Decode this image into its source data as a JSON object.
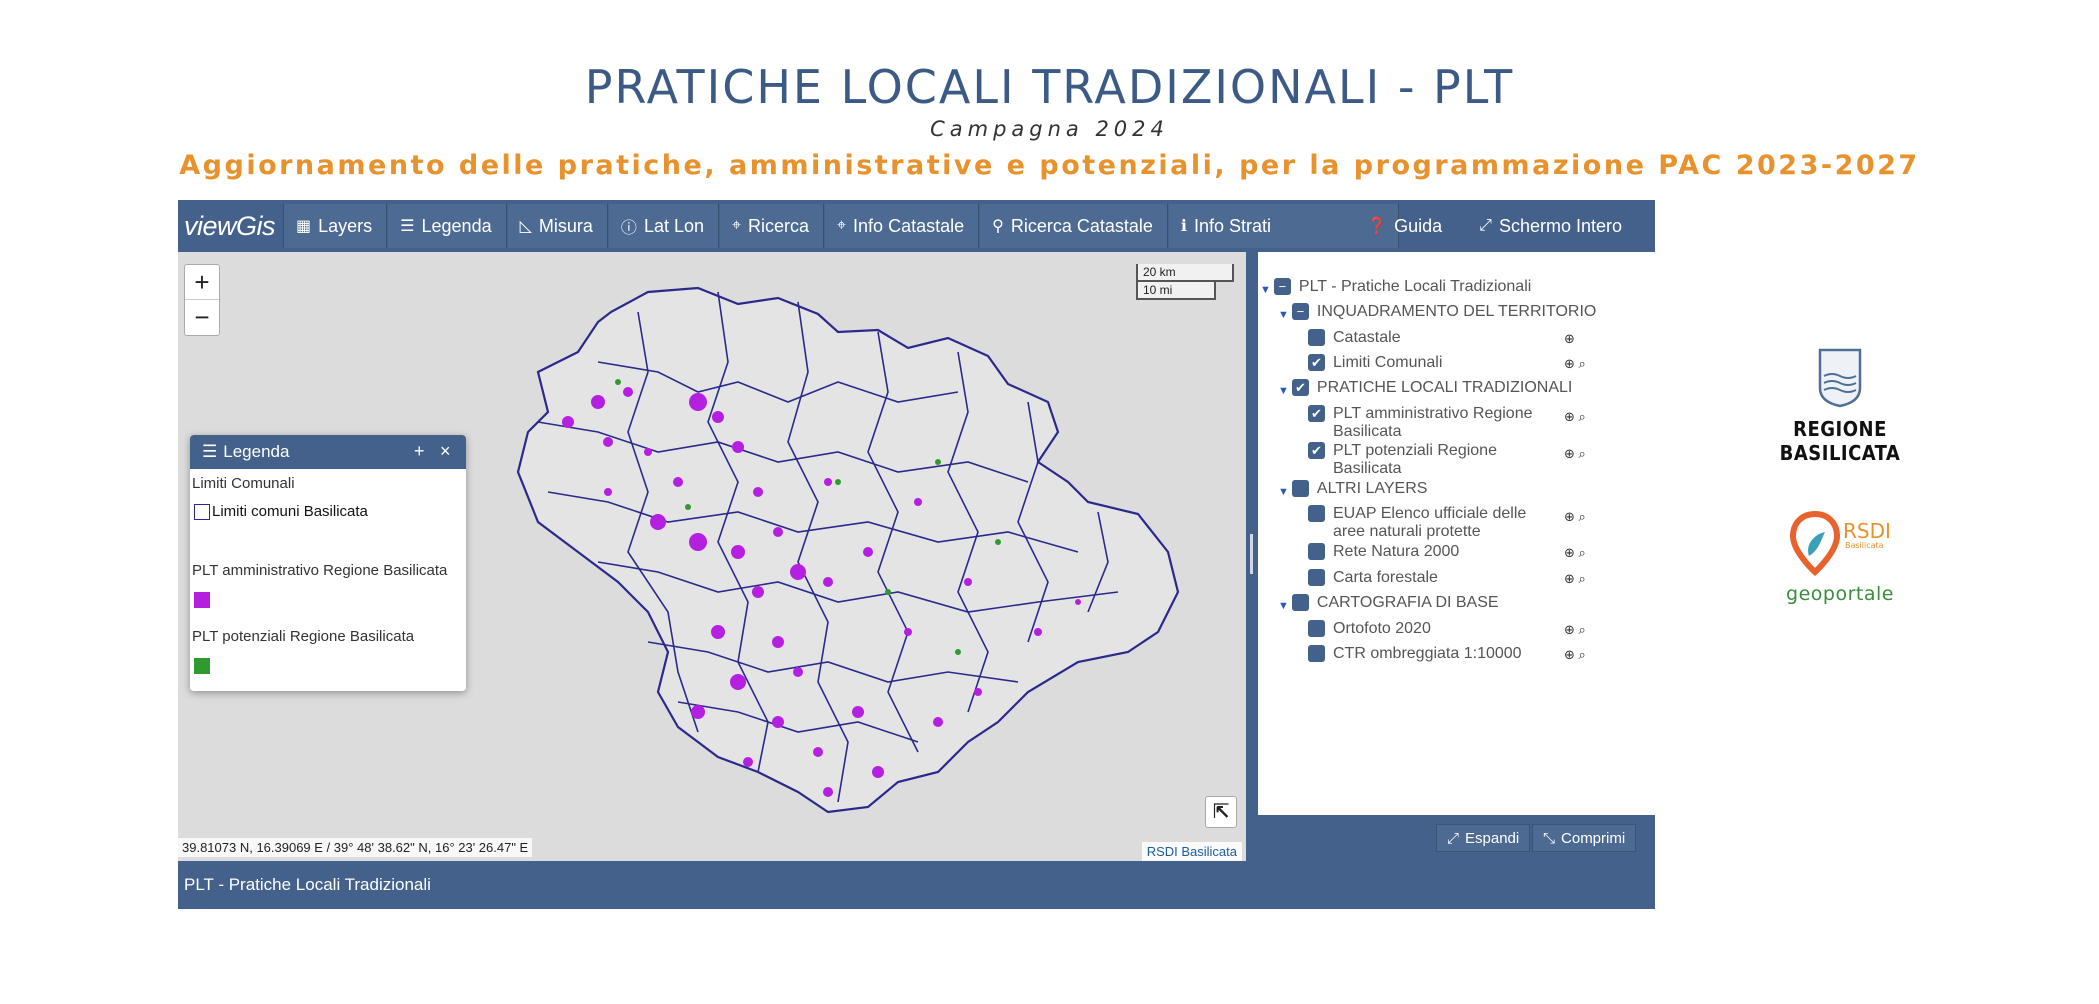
{
  "header": {
    "title": "PRATICHE LOCALI TRADIZIONALI - PLT",
    "subtitle": "Campagna 2024",
    "banner": "Aggiornamento delle pratiche, amministrative e potenziali, per la programmazione PAC 2023-2027"
  },
  "toolbar": {
    "brand": "viewGis",
    "items": [
      {
        "label": "Layers",
        "icon": "layers-icon"
      },
      {
        "label": "Legenda",
        "icon": "list-icon"
      },
      {
        "label": "Misura",
        "icon": "ruler-icon"
      },
      {
        "label": "Lat Lon",
        "icon": "info-icon"
      },
      {
        "label": "Ricerca",
        "icon": "map-marker-icon"
      },
      {
        "label": "Info Catastale",
        "icon": "map-marker-icon"
      },
      {
        "label": "Ricerca Catastale",
        "icon": "search-icon"
      },
      {
        "label": "Info Strati",
        "icon": "info-icon"
      }
    ],
    "right": [
      {
        "label": "Guida",
        "icon": "question-icon"
      },
      {
        "label": "Schermo Intero",
        "icon": "fullscreen-icon"
      }
    ]
  },
  "map": {
    "zoom_in": "+",
    "zoom_out": "−",
    "scale_km": "20 km",
    "scale_mi": "10 mi",
    "coordinates": "39.81073 N, 16.39069 E / 39° 48' 38.62\" N, 16° 23' 26.47\" E",
    "attribution": "RSDI Basilicata",
    "expand_glyph": "⇱"
  },
  "legend": {
    "title": "Legenda",
    "add": "+",
    "close": "×",
    "sections": [
      {
        "title": "Limiti Comunali",
        "item": "Limiti comuni Basilicata",
        "color": "#ffffff"
      },
      {
        "title": "PLT amministrativo Regione Basilicata",
        "color": "#b51fe0"
      },
      {
        "title": "PLT potenziali Regione Basilicata",
        "color": "#2f9a2f"
      }
    ]
  },
  "tree": {
    "root": "PLT - Pratiche Locali Tradizionali",
    "groups": [
      {
        "label": "INQUADRAMENTO DEL TERRITORIO",
        "items": [
          {
            "label": "Catastale",
            "checked": false
          },
          {
            "label": "Limiti Comunali",
            "checked": true
          }
        ]
      },
      {
        "label": "PRATICHE LOCALI TRADIZIONALI",
        "items": [
          {
            "label": "PLT amministrativo Regione Basilicata",
            "checked": true
          },
          {
            "label": "PLT potenziali Regione Basilicata",
            "checked": true
          }
        ]
      },
      {
        "label": "ALTRI LAYERS",
        "items": [
          {
            "label": "EUAP Elenco ufficiale delle aree naturali protette",
            "checked": false
          },
          {
            "label": "Rete Natura 2000",
            "checked": false
          },
          {
            "label": "Carta forestale",
            "checked": false
          }
        ]
      },
      {
        "label": "CARTOGRAFIA DI BASE",
        "items": [
          {
            "label": "Ortofoto 2020",
            "checked": false
          },
          {
            "label": "CTR ombreggiata 1:10000",
            "checked": false
          }
        ]
      }
    ]
  },
  "panel_footer": {
    "expand": "Espandi",
    "collapse": "Comprimi"
  },
  "status": "PLT - Pratiche Locali Tradizionali",
  "logos": {
    "regione": "REGIONE BASILICATA",
    "rsdi": "RSDI",
    "rsdi_sub": "Basilicata",
    "geoportale": "geoportale"
  },
  "colors": {
    "accent": "#43618a",
    "title": "#3b5b86",
    "banner": "#e8922e",
    "plt_amministrativo": "#b51fe0",
    "plt_potenziali": "#2f9a2f",
    "boundaries": "#2a2a8c"
  }
}
